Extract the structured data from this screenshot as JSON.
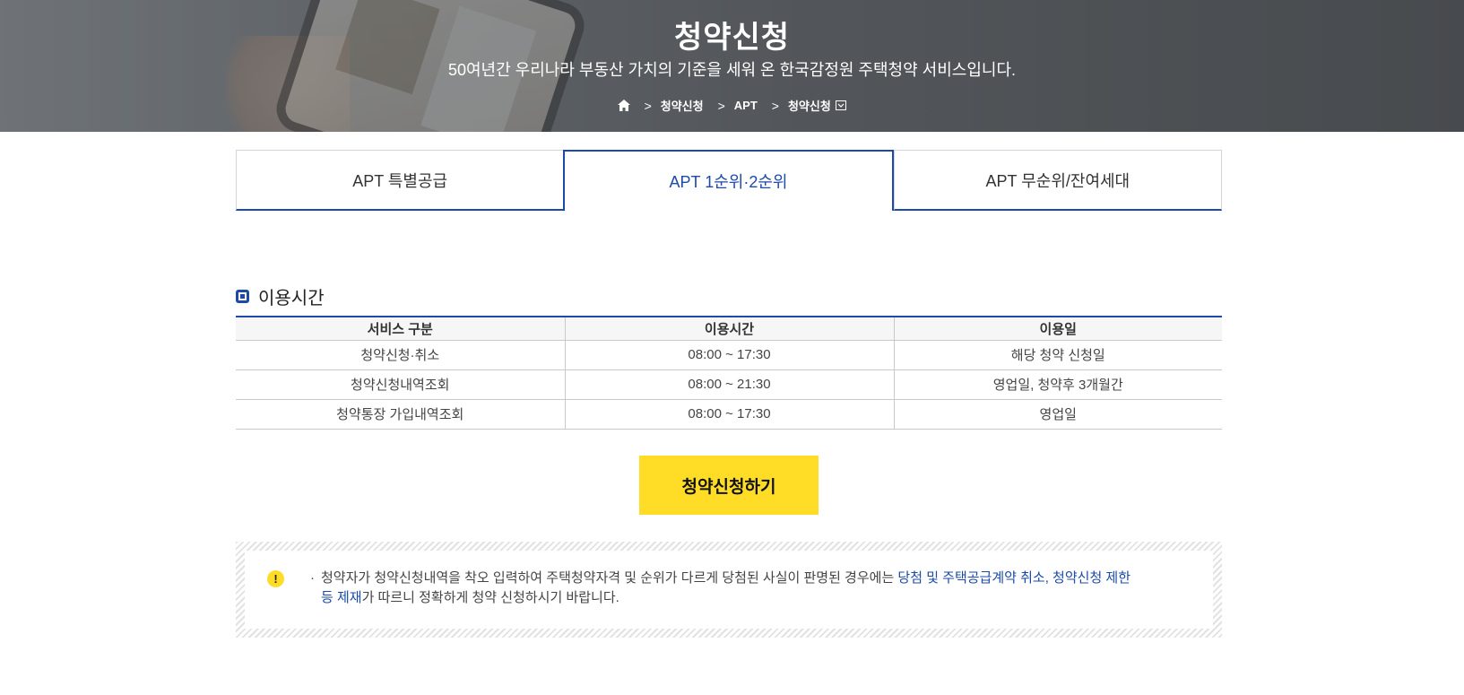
{
  "hero": {
    "title": "청약신청",
    "subtitle": "50여년간 우리나라 부동산 가치의 기준을 세워 온 한국감정원 주택청약 서비스입니다.",
    "breadcrumb": [
      "청약신청",
      "APT",
      "청약신청"
    ]
  },
  "tabs": [
    {
      "label": "APT 특별공급",
      "active": false
    },
    {
      "label": "APT 1순위·2순위",
      "active": true
    },
    {
      "label": "APT 무순위/잔여세대",
      "active": false
    }
  ],
  "section": {
    "title": "이용시간"
  },
  "table": {
    "headers": [
      "서비스 구분",
      "이용시간",
      "이용일"
    ],
    "rows": [
      [
        "청약신청·취소",
        "08:00 ~ 17:30",
        "해당 청약 신청일"
      ],
      [
        "청약신청내역조회",
        "08:00 ~ 21:30",
        "영업일, 청약후 3개월간"
      ],
      [
        "청약통장 가입내역조회",
        "08:00 ~ 17:30",
        "영업일"
      ]
    ]
  },
  "cta": {
    "label": "청약신청하기"
  },
  "notice": {
    "bullet": "·",
    "text_before": "청약자가 청약신청내역을 착오 입력하여 주택청약자격 및 순위가 다르게 당첨된 사실이 판명된 경우에는 ",
    "highlight": "당첨 및 주택공급계약 취소, 청약신청 제한 등 제재",
    "text_after": "가 따르니 정확하게 청약 신청하시기 바랍니다.",
    "icon_symbol": "!"
  },
  "colors": {
    "accent": "#1c4aa8",
    "button": "#ffdd26"
  }
}
